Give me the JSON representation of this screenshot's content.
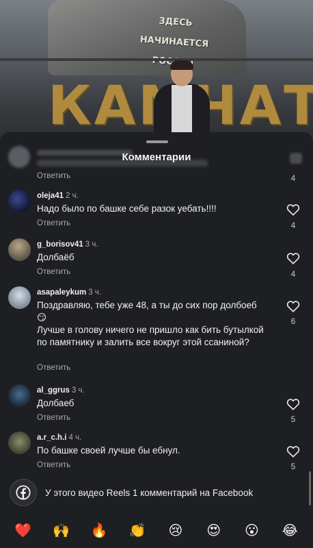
{
  "video": {
    "monument_text": [
      "ЗДЕСЬ",
      "НАЧИНАЕТСЯ",
      "РОССИЯ"
    ],
    "big_letters": "КАМЧАТКА"
  },
  "sheet": {
    "title": "Комментарии",
    "hidden_comment": {
      "reply_label": "Ответить",
      "likes": "4"
    }
  },
  "comments": [
    {
      "username": "oleja41",
      "time": "2 ч.",
      "text": "Надо было по башке  себе разок уебать!!!!",
      "reply_label": "Ответить",
      "likes": "4"
    },
    {
      "username": "g_borisov41",
      "time": "3 ч.",
      "text": "Долбаёб",
      "reply_label": "Ответить",
      "likes": "4"
    },
    {
      "username": "asapaleykum",
      "time": "3 ч.",
      "text": "Поздравляю, тебе уже 48, а ты до сих пор долбоеб😏",
      "text2": "Лучше в голову ничего не пришло как бить бутылкой по памятнику и залить все вокруг этой ссаниной?",
      "reply_label": "Ответить",
      "likes": "6"
    },
    {
      "username": "al_ggrus",
      "time": "3 ч.",
      "text": "Долбаеб",
      "reply_label": "Ответить",
      "likes": "5"
    },
    {
      "username": "a.r_c.h.i",
      "time": "4 ч.",
      "text": "По башке своей лучше бы ебнул.",
      "reply_label": "Ответить",
      "likes": "5"
    }
  ],
  "facebook_note": "У этого видео Reels 1 комментарий на Facebook",
  "reactions": [
    "❤️",
    "🙌",
    "🔥",
    "👏",
    "😢",
    "😍",
    "😮",
    "😂"
  ],
  "colors": {
    "sheet_bg": "#1e1f22",
    "secondary_text": "#a8a8a8"
  }
}
